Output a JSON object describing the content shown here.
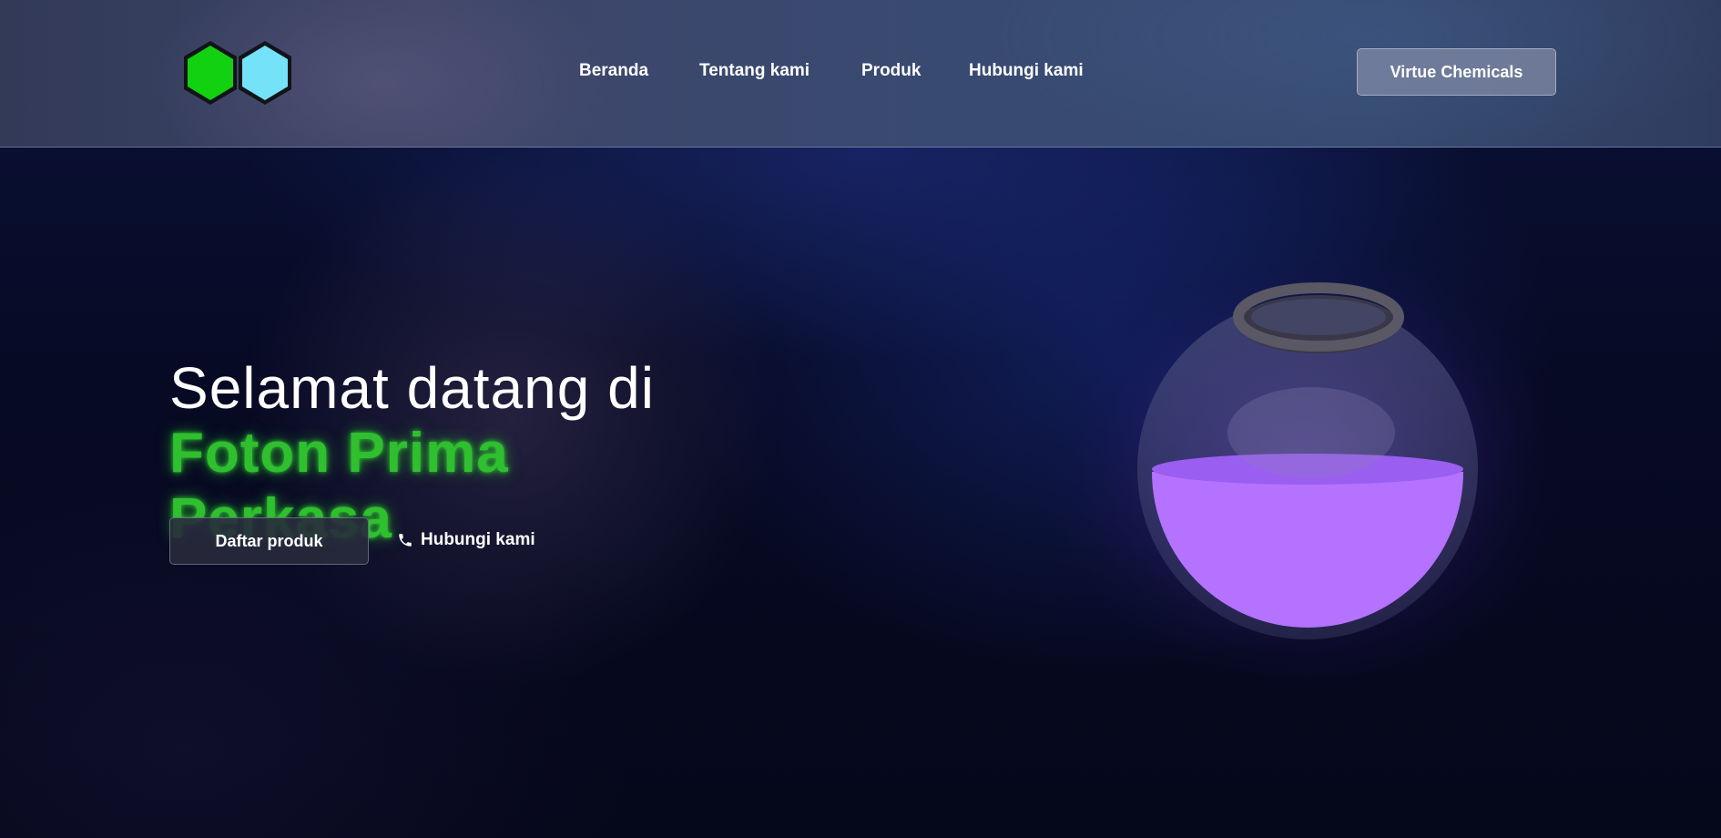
{
  "header": {
    "logo_icon": "hexagon-pair-logo-icon",
    "logo_colors": {
      "left_hexagon": "#11d111",
      "right_hexagon": "#74e2f8"
    },
    "nav": [
      {
        "label": "Beranda"
      },
      {
        "label": "Tentang kami"
      },
      {
        "label": "Produk"
      },
      {
        "label": "Hubungi kami"
      }
    ],
    "brand_button_label": "Virtue Chemicals"
  },
  "hero": {
    "title_line1": "Selamat datang di",
    "title_line2": "Foton Prima Perkasa",
    "title_accent_color": "#2fbf2f",
    "primary_button_label": "Daftar produk",
    "contact_link_label": "Hubungi kami",
    "contact_icon": "phone-icon"
  },
  "illustration": {
    "icon": "round-flask-icon",
    "liquid_color": "#b472ff"
  }
}
